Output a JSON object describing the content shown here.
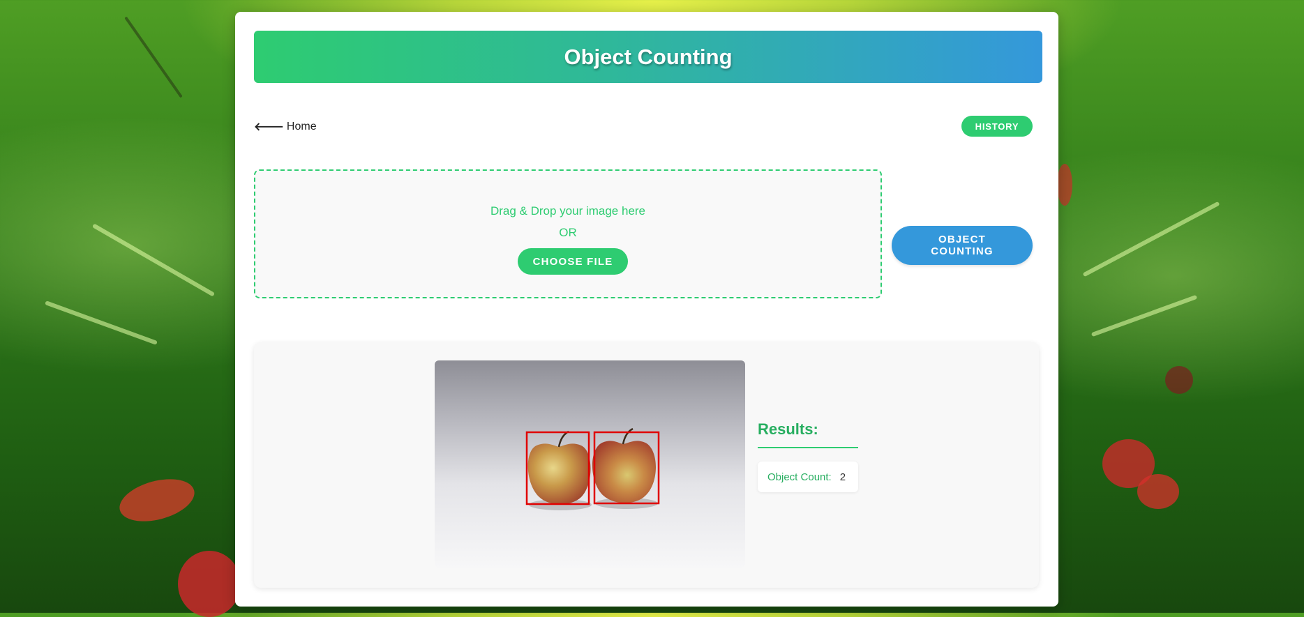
{
  "header": {
    "title": "Object Counting"
  },
  "nav": {
    "home_icon": "arrow-left-icon",
    "home_label": "Home",
    "history_label": "HISTORY"
  },
  "upload": {
    "drag_text": "Drag & Drop your image here",
    "or_text": "OR",
    "choose_label": "CHOOSE FILE"
  },
  "action": {
    "count_label_line1": "OBJECT",
    "count_label_line2": "COUNTING"
  },
  "results": {
    "title": "Results:",
    "count_label": "Object Count:",
    "count_value": "2"
  },
  "colors": {
    "accent_green": "#2ecc71",
    "accent_blue": "#3498db",
    "results_green": "#27ae60",
    "detection_box": "#e00000"
  }
}
